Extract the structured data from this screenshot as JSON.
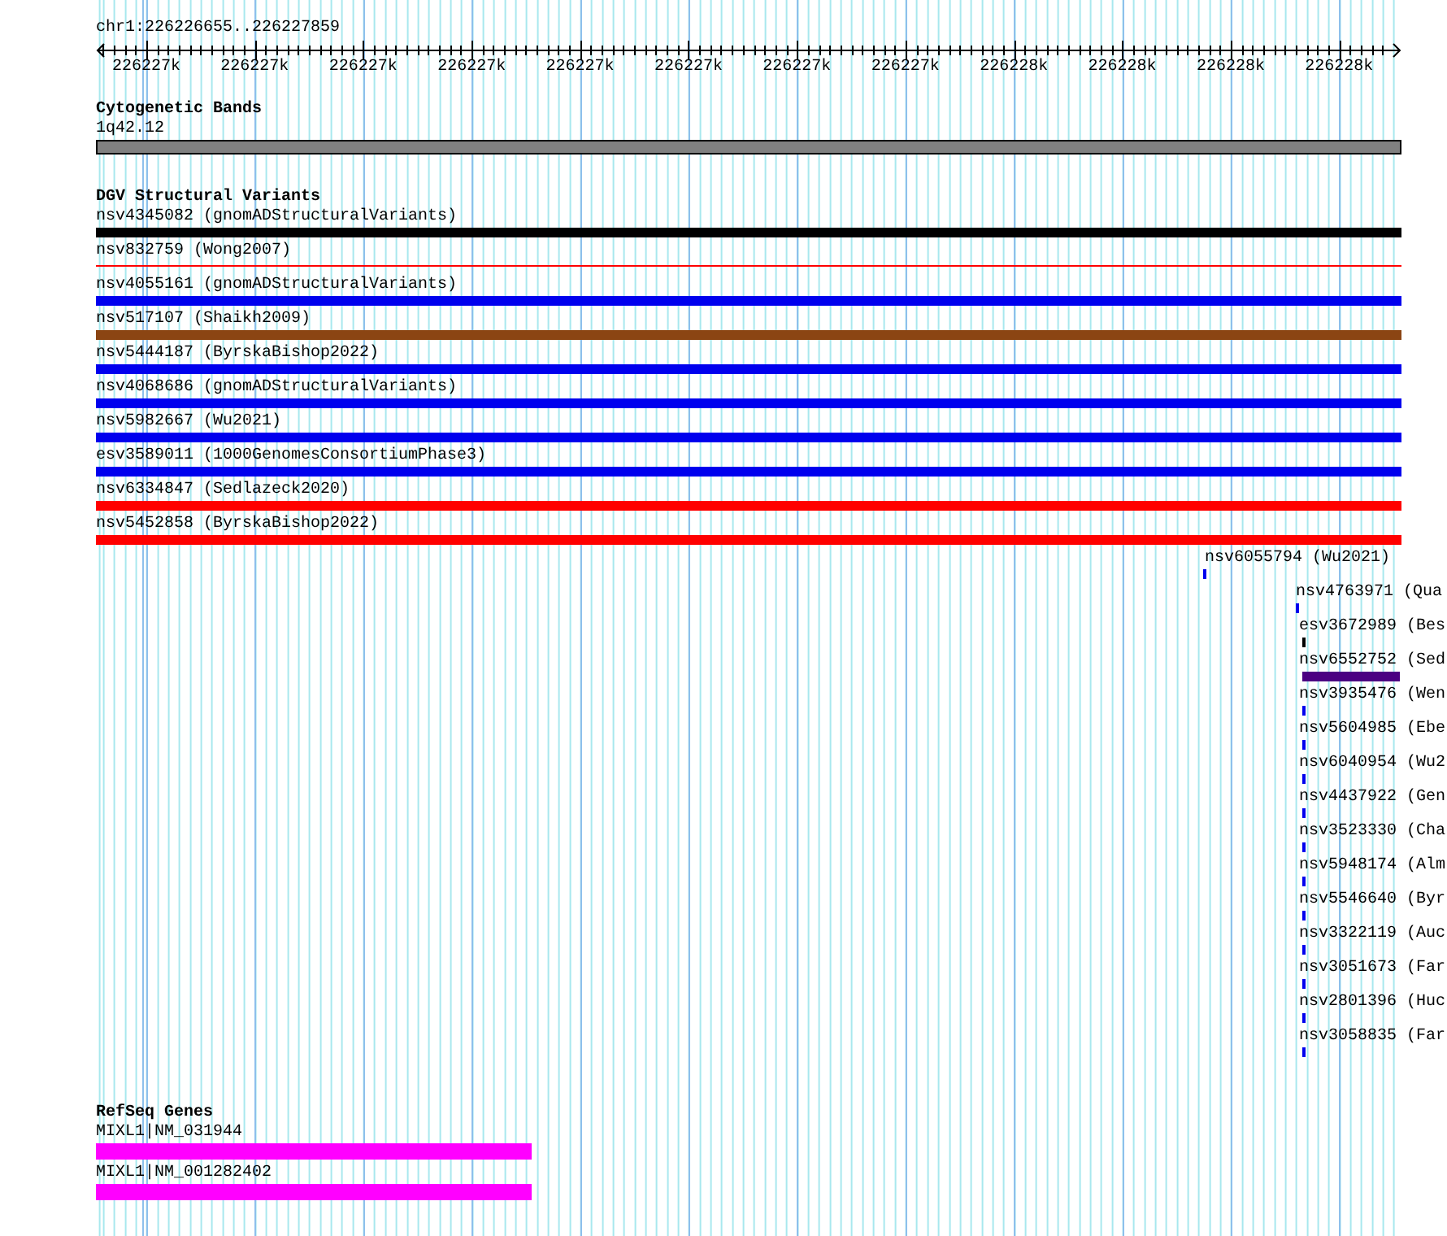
{
  "region": "chr1:226226655..226227859",
  "ruler": {
    "ticks": [
      "226227k",
      "226227k",
      "226227k",
      "226227k",
      "226227k",
      "226227k",
      "226227k",
      "226227k",
      "226228k",
      "226228k",
      "226228k",
      "226228k"
    ]
  },
  "tracks": [
    {
      "kind": "bands",
      "title": "Cytogenetic Bands",
      "features": [
        {
          "label": "1q42.12",
          "color": "#808080",
          "kind": "thick"
        }
      ]
    },
    {
      "kind": "variants",
      "title": "DGV Structural Variants",
      "features": [
        {
          "label": "nsv4345082 (gnomADStructuralVariants)",
          "color": "#000000",
          "kind": "thick"
        },
        {
          "label": "nsv832759 (Wong2007)",
          "color": "#ff0000",
          "kind": "thin"
        },
        {
          "label": "nsv4055161 (gnomADStructuralVariants)",
          "color": "#0000ee",
          "kind": "thick"
        },
        {
          "label": "nsv517107 (Shaikh2009)",
          "color": "#8b4513",
          "kind": "thick"
        },
        {
          "label": "nsv5444187 (ByrskaBishop2022)",
          "color": "#0000ee",
          "kind": "thick"
        },
        {
          "label": "nsv4068686 (gnomADStructuralVariants)",
          "color": "#0000ee",
          "kind": "thick"
        },
        {
          "label": "nsv5982667 (Wu2021)",
          "color": "#0000ee",
          "kind": "thick"
        },
        {
          "label": "esv3589011 (1000GenomesConsortiumPhase3)",
          "color": "#0000ee",
          "kind": "thick"
        },
        {
          "label": "nsv6334847 (Sedlazeck2020)",
          "color": "#ff0000",
          "kind": "thick"
        },
        {
          "label": "nsv5452858 (ByrskaBishop2022)",
          "color": "#ff0000",
          "kind": "thick"
        },
        {
          "label": "nsv6055794 (Wu2021)",
          "color": "#0000ee",
          "kind": "thick"
        },
        {
          "label": "nsv4763971 (Qua",
          "color": "#0000ee",
          "kind": "thick"
        },
        {
          "label": "esv3672989 (Bes",
          "color": "#000000",
          "kind": "thick"
        },
        {
          "label": "nsv6552752 (Sed",
          "color": "#4b0082",
          "kind": "thick"
        },
        {
          "label": "nsv3935476 (Wen",
          "color": "#0000ee",
          "kind": "thick"
        },
        {
          "label": "nsv5604985 (Ebe",
          "color": "#0000ee",
          "kind": "thick"
        },
        {
          "label": "nsv6040954 (Wu2",
          "color": "#0000ee",
          "kind": "thick"
        },
        {
          "label": "nsv4437922 (Gen",
          "color": "#0000ee",
          "kind": "thick"
        },
        {
          "label": "nsv3523330 (Cha",
          "color": "#0000ee",
          "kind": "thick"
        },
        {
          "label": "nsv5948174 (Alm",
          "color": "#0000ee",
          "kind": "thick"
        },
        {
          "label": "nsv5546640 (Byr",
          "color": "#0000ee",
          "kind": "thick"
        },
        {
          "label": "nsv3322119 (Auc",
          "color": "#0000ee",
          "kind": "thick"
        },
        {
          "label": "nsv3051673 (Far",
          "color": "#0000ee",
          "kind": "thick"
        },
        {
          "label": "nsv2801396 (Huc",
          "color": "#0000ee",
          "kind": "thick"
        },
        {
          "label": "nsv3058835 (Far",
          "color": "#0000ee",
          "kind": "thick"
        }
      ]
    },
    {
      "kind": "genes",
      "title": "RefSeq Genes",
      "features": [
        {
          "label": "MIXL1|NM_031944",
          "color": "#ff00ff",
          "kind": "thick"
        },
        {
          "label": "MIXL1|NM_001282402",
          "color": "#ff00ff",
          "kind": "thick"
        }
      ]
    }
  ]
}
